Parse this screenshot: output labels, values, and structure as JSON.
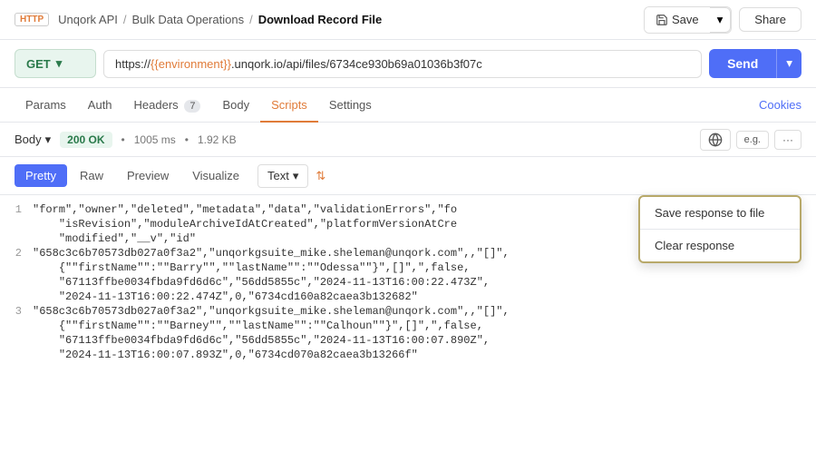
{
  "header": {
    "http_badge": "HTTP",
    "breadcrumb": {
      "item1": "Unqork API",
      "item2": "Bulk Data Operations",
      "item3": "Download Record File"
    },
    "save_label": "Save",
    "share_label": "Share"
  },
  "url_bar": {
    "method": "GET",
    "url_prefix": "https://",
    "url_env": "{{environment}}",
    "url_suffix": ".unqork.io/api/files/6734ce930b69a01036b3f07c",
    "send_label": "Send"
  },
  "tabs": {
    "items": [
      {
        "label": "Params",
        "active": false
      },
      {
        "label": "Auth",
        "active": false
      },
      {
        "label": "Headers",
        "active": false,
        "badge": "7"
      },
      {
        "label": "Body",
        "active": false
      },
      {
        "label": "Scripts",
        "active": true
      },
      {
        "label": "Settings",
        "active": false
      }
    ],
    "cookies_label": "Cookies"
  },
  "response_bar": {
    "body_label": "Body",
    "status": "200 OK",
    "time": "1005 ms",
    "size": "1.92 KB"
  },
  "format_bar": {
    "pretty_label": "Pretty",
    "raw_label": "Raw",
    "preview_label": "Preview",
    "visualize_label": "Visualize",
    "text_label": "Text",
    "sort_icon": "⇅"
  },
  "dropdown": {
    "save_response_label": "Save response to file",
    "clear_response_label": "Clear response"
  },
  "code_lines": [
    {
      "num": "1",
      "content": "\"form\",\"owner\",\"deleted\",\"metadata\",\"data\",\"validationErrors\",\"fo"
    },
    {
      "num": "",
      "content": "    \"isRevision\",\"moduleArchiveIdAtCreated\",\"platformVersionAtCre"
    },
    {
      "num": "",
      "content": "    \"modified\",\"__v\",\"id\""
    },
    {
      "num": "2",
      "content": "\"658c3c6b70573db027a0f3a2\",\"unqorkgsuite_mike.sheleman@unqork.com\",,\"[]\","
    },
    {
      "num": "",
      "content": "    {\"\"firstName\"\":\"\"Barry\"\",\"\"lastName\"\":\"\"Odessa\"\"}\",[]\",\",false,"
    },
    {
      "num": "",
      "content": "    \"67113ffbe0034fbda9fd6d6c\",\"56dd5855c\",\"2024-11-13T16:00:22.473Z\","
    },
    {
      "num": "",
      "content": "    \"2024-11-13T16:00:22.474Z\",0,\"6734cd160a82caea3b132682\""
    },
    {
      "num": "3",
      "content": "\"658c3c6b70573db027a0f3a2\",\"unqorkgsuite_mike.sheleman@unqork.com\",,\"[]\","
    },
    {
      "num": "",
      "content": "    {\"\"firstName\"\":\"\"Barney\"\",\"\"lastName\"\":\"\"Calhoun\"\"}\",[]\",\",false,"
    },
    {
      "num": "",
      "content": "    \"67113ffbe0034fbda9fd6d6c\",\"56dd5855c\",\"2024-11-13T16:00:07.890Z\","
    },
    {
      "num": "",
      "content": "    \"2024-11-13T16:00:07.893Z\",0,\"6734cd070a82caea3b13266f\""
    }
  ]
}
